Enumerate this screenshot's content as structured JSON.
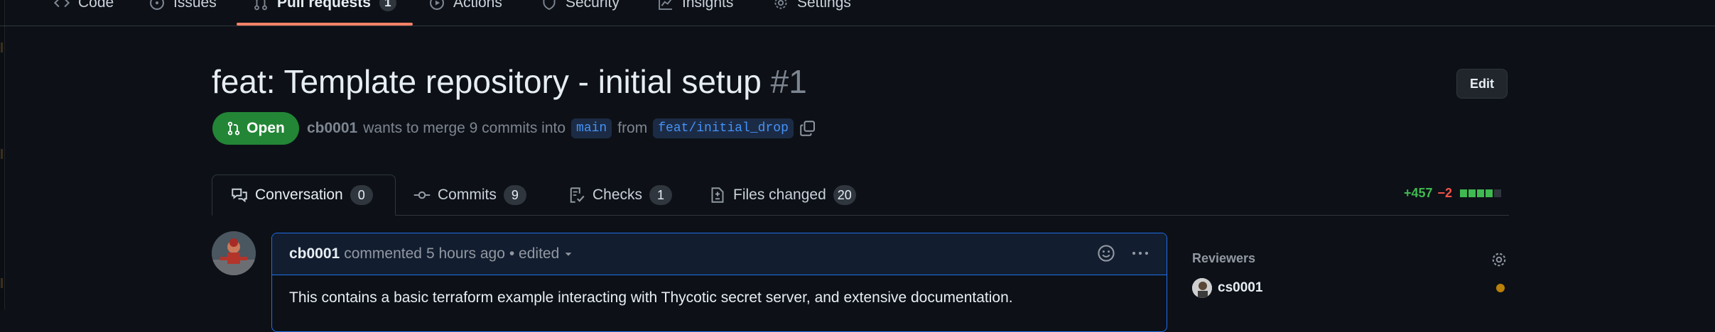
{
  "repo_nav": {
    "items": [
      {
        "label": "Code",
        "icon": "code-icon"
      },
      {
        "label": "Issues",
        "icon": "issue-opened-icon"
      },
      {
        "label": "Pull requests",
        "icon": "git-pull-request-icon",
        "count": "1",
        "active": true
      },
      {
        "label": "Actions",
        "icon": "play-icon"
      },
      {
        "label": "Security",
        "icon": "shield-icon"
      },
      {
        "label": "Insights",
        "icon": "graph-icon"
      },
      {
        "label": "Settings",
        "icon": "gear-icon"
      }
    ]
  },
  "pr": {
    "title": "feat: Template repository - initial setup",
    "number": "#1",
    "edit_label": "Edit",
    "state": "Open",
    "author": "cb0001",
    "merge_text": "wants to merge 9 commits into",
    "base_branch": "main",
    "from_text": "from",
    "head_branch": "feat/initial_drop"
  },
  "tabs": [
    {
      "label": "Conversation",
      "count": "0",
      "icon": "comment-discussion-icon"
    },
    {
      "label": "Commits",
      "count": "9",
      "icon": "git-commit-icon"
    },
    {
      "label": "Checks",
      "count": "1",
      "icon": "checklist-icon"
    },
    {
      "label": "Files changed",
      "count": "20",
      "icon": "file-diff-icon"
    }
  ],
  "diffstat": {
    "additions": "+457",
    "deletions": "−2",
    "blocks_added": 4,
    "blocks_neutral": 1
  },
  "comment": {
    "author": "cb0001",
    "action": "commented",
    "time": "5 hours ago",
    "edited": "• edited",
    "body": "This contains a basic terraform example interacting with Thycotic secret server, and extensive documentation."
  },
  "sidebar": {
    "reviewers_heading": "Reviewers",
    "reviewer": "cs0001"
  },
  "colors": {
    "background": "#0d1117",
    "accent_open": "#238636",
    "active_underline": "#f78166",
    "link_blue": "#4493f8",
    "pending_dot": "#bb8009"
  }
}
